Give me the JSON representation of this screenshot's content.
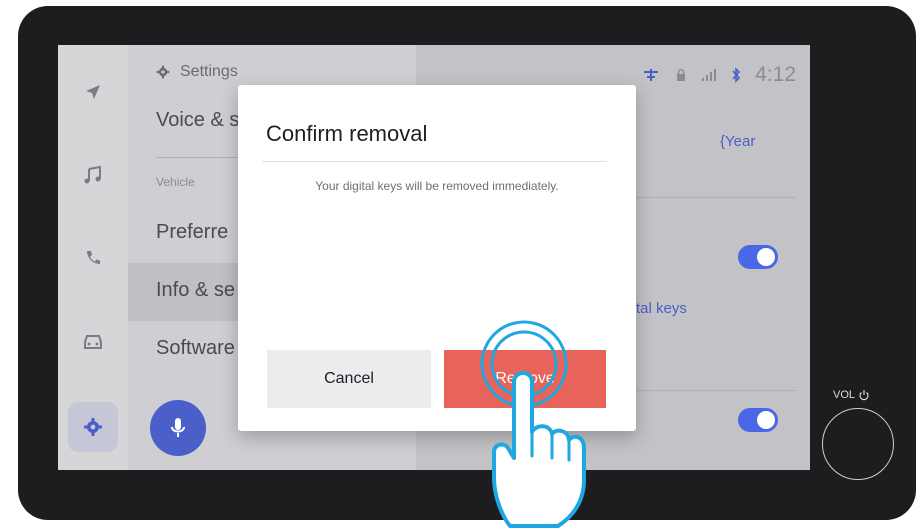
{
  "status": {
    "time": "4:12"
  },
  "nav": {
    "items": [
      "navigation-icon",
      "music-icon",
      "phone-icon",
      "car-icon",
      "settings-icon"
    ],
    "active": "settings-icon"
  },
  "menu": {
    "header": "Settings",
    "items": [
      {
        "label": "Voice & s"
      },
      {
        "label": "Vehicle",
        "section": true
      },
      {
        "label": "Preferre"
      },
      {
        "label": "Info & se",
        "highlighted": true
      },
      {
        "label": "Software"
      }
    ]
  },
  "right": {
    "year_text": "{Year",
    "digital_keys_text": "tal keys"
  },
  "dialog": {
    "title": "Confirm removal",
    "message": "Your digital keys will be removed immediately.",
    "cancel_label": "Cancel",
    "remove_label": "Remove"
  },
  "hardware": {
    "vol_label": "VOL"
  },
  "colors": {
    "accent": "#4a67e8",
    "remove": "#e8645a"
  }
}
